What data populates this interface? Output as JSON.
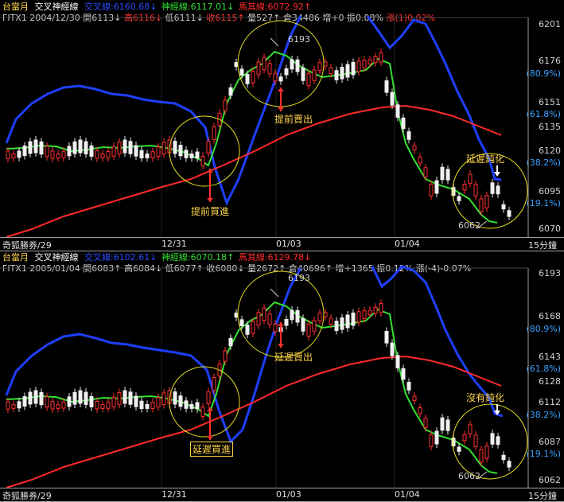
{
  "panels": [
    {
      "top": {
        "contract": "台當月",
        "indicator_name": "交叉神經線",
        "line1": "交叉線:6160.68↓",
        "line2": "神經線:6117.01↓",
        "line3": "馬其線:6072.92↑"
      },
      "sub": {
        "symbol": "FITX1",
        "date": "2004/12/30",
        "open": "開6113↓",
        "high": "高6116↓",
        "low": "低6111↓",
        "close": "收6115↑",
        "volume": "量527↑",
        "oi": "倉34486",
        "chg": "增+0",
        "amp": "振0.08%",
        "rise": "漲(1)0.02%"
      },
      "yaxis": [
        {
          "v": "6201",
          "pct": false
        },
        {
          "v": "6176",
          "pct": false
        },
        {
          "v": "(80.9%)",
          "pct": true
        },
        {
          "v": "6151",
          "pct": false
        },
        {
          "v": "(61.8%)",
          "pct": true
        },
        {
          "v": "6135",
          "pct": false
        },
        {
          "v": "6120",
          "pct": false
        },
        {
          "v": "(38.2%)",
          "pct": true
        },
        {
          "v": "6095",
          "pct": false
        },
        {
          "v": "(19.1%)",
          "pct": true
        },
        {
          "v": "6070",
          "pct": false
        }
      ],
      "annotations": {
        "peak": "6193",
        "trough": "6062",
        "buy": "提前買進",
        "sell": "提前賣出",
        "dull": "延遲鈍化"
      },
      "xaxis": {
        "corner": "奇狐勝券/29",
        "d1": "12/31",
        "d2": "01/03",
        "d3": "01/04",
        "period": "15分鐘"
      }
    },
    {
      "top": {
        "contract": "台當月",
        "indicator_name": "交叉神經線",
        "line1": "交叉線:6102.61↓",
        "line2": "神經線:6070.18↑",
        "line3": "馬其線:6129.78↓"
      },
      "sub": {
        "symbol": "FITX1",
        "date": "2005/01/04",
        "open": "開6083↑",
        "high": "高6084↓",
        "low": "低6077↑",
        "close": "收6080↓",
        "volume": "量2672↑",
        "oi": "倉40696↑",
        "chg": "增+1365",
        "amp": "振0.12%",
        "rise": "漲(-4)-0.07%"
      },
      "yaxis": [
        {
          "v": "6193",
          "pct": false
        },
        {
          "v": "6168",
          "pct": false
        },
        {
          "v": "(80.9%)",
          "pct": true
        },
        {
          "v": "6143",
          "pct": false
        },
        {
          "v": "(61.8%)",
          "pct": true
        },
        {
          "v": "6128",
          "pct": false
        },
        {
          "v": "6112",
          "pct": false
        },
        {
          "v": "(38.2%)",
          "pct": true
        },
        {
          "v": "6087",
          "pct": false
        },
        {
          "v": "(19.1%)",
          "pct": true
        },
        {
          "v": "6062",
          "pct": false
        }
      ],
      "annotations": {
        "peak": "6193",
        "trough": "6062",
        "buy": "延遲買進",
        "sell": "延遲賣出",
        "dull": "沒有鈍化"
      },
      "xaxis": {
        "corner": "奇狐勝券/29",
        "d1": "12/31",
        "d2": "01/03",
        "d3": "01/04",
        "period": "15分鐘"
      }
    }
  ],
  "colors": {
    "contract": "#ffd54a",
    "indicator": "#ffffff",
    "line1": "#1f3fff",
    "line2": "#33e033",
    "line3": "#ff2a2a",
    "sub": "#d0d0d0",
    "rise": "#ff3030",
    "annot": "#ffd54a"
  }
}
